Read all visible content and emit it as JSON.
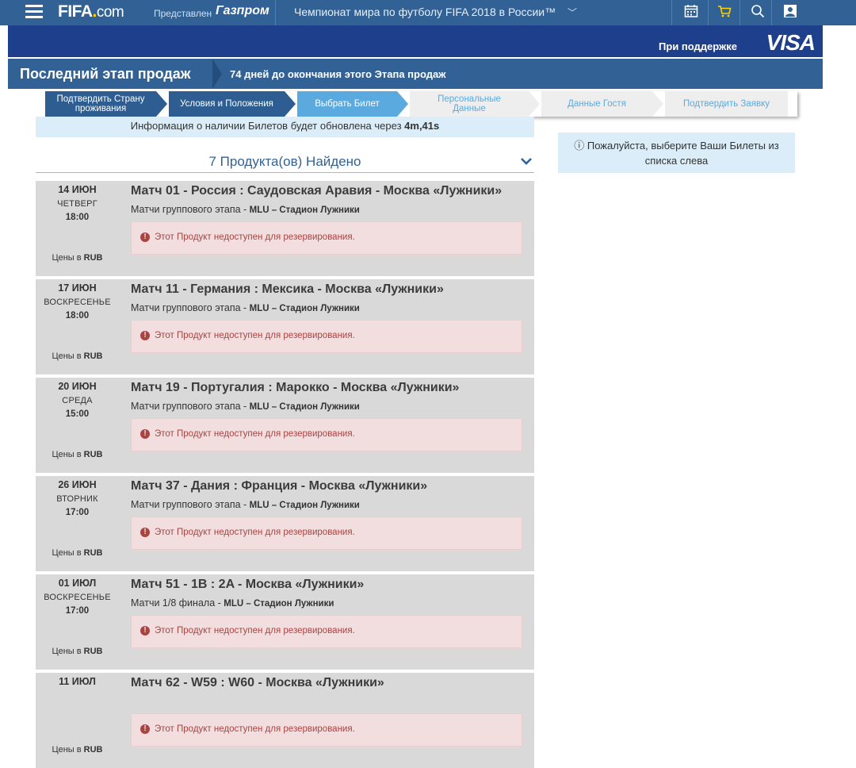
{
  "topbar": {
    "logo_main": "FIFA",
    "logo_dot": ".",
    "logo_com": "com",
    "presented": "Представлен",
    "sponsor": "Газпром",
    "championship": "Чемпионат мира по футболу FIFA 2018 в России™",
    "championship_chevron": "﹀"
  },
  "visabar": {
    "support": "При поддержке",
    "brand": "VISA"
  },
  "stage": {
    "title": "Последний этап продаж",
    "days_left": "74 дней до окончания этого Этапа продаж"
  },
  "steps": [
    {
      "label": "Подтвердить Страну проживания",
      "state": "done"
    },
    {
      "label": "Условия и Положения",
      "state": "done"
    },
    {
      "label": "Выбрать Билет",
      "state": "active"
    },
    {
      "label": "Персональные Данные",
      "state": "pending"
    },
    {
      "label": "Данные Гостя",
      "state": "pending"
    },
    {
      "label": "Подтвердить Заявку",
      "state": "pending"
    }
  ],
  "update_banner": {
    "text": "Информация о наличии Билетов будет обновлена через ",
    "timer": "4m,41s"
  },
  "found": {
    "text": "7 Продукта(ов) Найдено"
  },
  "side_note": {
    "text": "Пожалуйста, выберите Ваши Билеты из списка слева"
  },
  "prices_label": "Цены в",
  "prices_currency": "RUB",
  "alert_text": "Этот Продукт недоступен для резервирования.",
  "products": [
    {
      "date": "14 ИЮН",
      "weekday": "ЧЕТВЕРГ",
      "time": "18:00",
      "title": "Матч 01 - Россия : Саудовская Аравия - Москва «Лужники»",
      "stage": "Матчи группового этапа - ",
      "venue": "MLU – Стадион Лужники"
    },
    {
      "date": "17 ИЮН",
      "weekday": "ВОСКРЕСЕНЬЕ",
      "time": "18:00",
      "title": "Матч 11 - Германия : Мексика - Москва «Лужники»",
      "stage": "Матчи группового этапа - ",
      "venue": "MLU – Стадион Лужники"
    },
    {
      "date": "20 ИЮН",
      "weekday": "СРЕДА",
      "time": "15:00",
      "title": "Матч 19 - Португалия : Марокко - Москва «Лужники»",
      "stage": "Матчи группового этапа - ",
      "venue": "MLU – Стадион Лужники"
    },
    {
      "date": "26 ИЮН",
      "weekday": "ВТОРНИК",
      "time": "17:00",
      "title": "Матч 37 - Дания : Франция - Москва «Лужники»",
      "stage": "Матчи группового этапа - ",
      "venue": "MLU – Стадион Лужники"
    },
    {
      "date": "01 ИЮЛ",
      "weekday": "ВОСКРЕСЕНЬЕ",
      "time": "17:00",
      "title": "Матч 51 - 1B : 2A - Москва «Лужники»",
      "stage": "Матчи 1/8 финала - ",
      "venue": "MLU – Стадион Лужники"
    },
    {
      "date": "11 ИЮЛ",
      "weekday": "",
      "time": "",
      "title": "Матч 62 - W59 : W60 - Москва «Лужники»",
      "stage": "",
      "venue": ""
    }
  ],
  "colors": {
    "topbar": "#326295",
    "visabar": "#1d3f8c",
    "step_done": "#2d5d91",
    "step_active": "#5aaae0",
    "step_pending_text": "#5aaae0",
    "alert_bg": "#f2dede",
    "alert_text": "#a94442"
  }
}
